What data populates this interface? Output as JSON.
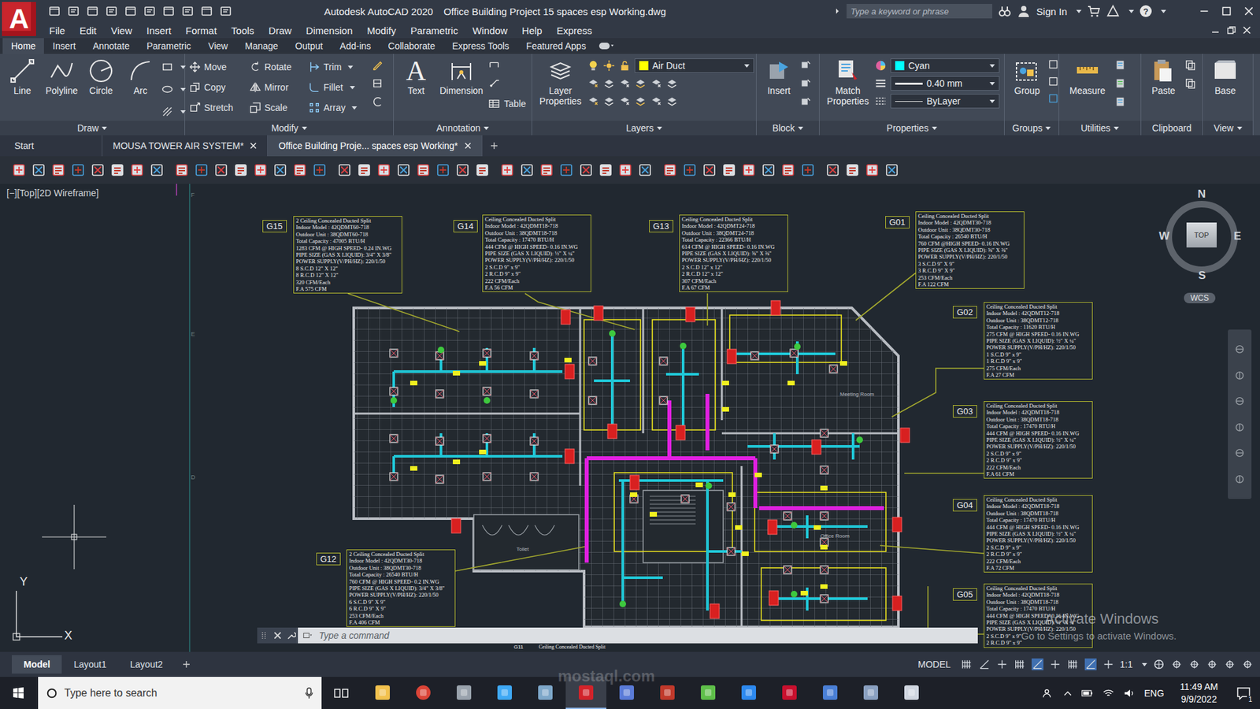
{
  "app": {
    "logo": "A",
    "title": "Autodesk AutoCAD 2020",
    "file": "Office Building Project 15 spaces esp Working.dwg",
    "search_placeholder": "Type a keyword or phrase",
    "sign_in": "Sign In",
    "help": "?"
  },
  "menu": [
    "File",
    "Edit",
    "View",
    "Insert",
    "Format",
    "Tools",
    "Draw",
    "Dimension",
    "Modify",
    "Parametric",
    "Window",
    "Help",
    "Express"
  ],
  "ribbon_tabs": [
    {
      "label": "Home",
      "selected": true
    },
    {
      "label": "Insert",
      "selected": false
    },
    {
      "label": "Annotate",
      "selected": false
    },
    {
      "label": "Parametric",
      "selected": false
    },
    {
      "label": "View",
      "selected": false
    },
    {
      "label": "Manage",
      "selected": false
    },
    {
      "label": "Output",
      "selected": false
    },
    {
      "label": "Add-ins",
      "selected": false
    },
    {
      "label": "Collaborate",
      "selected": false
    },
    {
      "label": "Express Tools",
      "selected": false
    },
    {
      "label": "Featured Apps",
      "selected": false
    }
  ],
  "ribbon": {
    "draw": {
      "title": "Draw",
      "tools": [
        "Line",
        "Polyline",
        "Circle",
        "Arc"
      ]
    },
    "modify": {
      "title": "Modify",
      "tools": [
        {
          "label": "Move",
          "menu": false
        },
        {
          "label": "Rotate",
          "menu": false
        },
        {
          "label": "Trim",
          "menu": true
        },
        {
          "label": "Copy",
          "menu": false
        },
        {
          "label": "Mirror",
          "menu": false
        },
        {
          "label": "Fillet",
          "menu": true
        },
        {
          "label": "Stretch",
          "menu": false
        },
        {
          "label": "Scale",
          "menu": false
        },
        {
          "label": "Array",
          "menu": true
        }
      ]
    },
    "annotation": {
      "title": "Annotation",
      "text_glyph": "A",
      "text": "Text",
      "dimension": "Dimension",
      "table": "Table"
    },
    "layers": {
      "title": "Layers",
      "properties": "Layer Properties",
      "current": "Air Duct",
      "current_color": "#ffff00"
    },
    "block": {
      "title": "Block",
      "insert": "Insert"
    },
    "properties": {
      "title": "Properties",
      "match": "Match Properties",
      "color": "Cyan",
      "color_swatch": "#00ffff",
      "lineweight": "0.40 mm",
      "linetype": "ByLayer"
    },
    "groups": {
      "title": "Groups",
      "group": "Group"
    },
    "utilities": {
      "title": "Utilities",
      "measure": "Measure"
    },
    "clipboard": {
      "title": "Clipboard",
      "paste": "Paste"
    },
    "view": {
      "title": "View",
      "base": "Base"
    }
  },
  "doc_tabs": [
    {
      "label": "Start",
      "selected": false,
      "closable": false
    },
    {
      "label": "MOUSA TOWER AIR SYSTEM*",
      "selected": false,
      "closable": true
    },
    {
      "label": "Office Building Proje... spaces esp Working*",
      "selected": true,
      "closable": true
    }
  ],
  "viewport": {
    "label": "[−][Top][2D Wireframe]",
    "ruler_marks": [
      "F",
      "E",
      "D"
    ],
    "ucs": {
      "x": "X",
      "y": "Y"
    }
  },
  "viewcube": {
    "north": "N",
    "south": "S",
    "west": "W",
    "east": "E",
    "face": "TOP",
    "ucs": "WCS"
  },
  "units": [
    {
      "tag": "G15",
      "lines": [
        "2 Ceiling Concealed Ducted Split",
        "Indoor Model : 42QDMT60-718",
        "Outdoor Unit : 38QDMT60-718",
        "Total Capacity : 47005 BTU/H",
        "1283 CFM @ HIGH SPEED- 0.24 IN.WG",
        "PIPE SIZE (GAS X LIQUID): 3/4\" X 3/8\"",
        "POWER SUPPLY(V/PH/HZ): 220/1/50",
        "8 S.C.D 12\" X 12\"",
        "8 R.C.D 12\" X 12\"",
        "320 CFM/Each",
        "F.A 575 CFM"
      ]
    },
    {
      "tag": "G14",
      "lines": [
        "Ceiling Concealed Ducted Split",
        "Indoor Model : 42QDMT18-718",
        "Outdoor Unit : 38QDMT18-718",
        "Total Capacity : 17470 BTU/H",
        "444 CFM @ HIGH SPEED- 0.16 IN.WG",
        "PIPE SIZE (GAS X LIQUID): ½\" X ¼\"",
        "POWER SUPPLY(V/PH/HZ): 220/1/50",
        "2 S.C.D 9\" x 9\"",
        "2 R.C.D 9\" x 9\"",
        "222 CFM/Each",
        "F.A 56 CFM"
      ]
    },
    {
      "tag": "G13",
      "lines": [
        "Ceiling Concealed Ducted Split",
        "Indoor Model : 42QDMT24-718",
        "Outdoor Unit : 38QDMT24-718",
        "Total Capacity : 22366 BTU/H",
        "614 CFM @ HIGH SPEED- 0.16 IN.WG",
        "PIPE SIZE (GAS X LIQUID): ⅝\" X ⅜\"",
        "POWER SUPPLY(V/PH/HZ): 220/1/50",
        "2 S.C.D 12\" x 12\"",
        "2 R.C.D 12\" x 12\"",
        "307 CFM/Each",
        "F.A 67 CFM"
      ]
    },
    {
      "tag": "G01",
      "lines": [
        "Ceiling Concealed Ducted Split",
        "Indoor Model : 42QDMT30-718",
        "Outdoor Unit : 38QDMT30-718",
        "Total Capacity : 26540 BTU/H",
        "760 CFM @HIGH SPEED- 0.16 IN.WG",
        "PIPE SIZE (GAS X LIQUID): ⅝\" X ⅜\"",
        "POWER SUPPLY(V/PH/HZ): 220/1/50",
        "3 S.C.D 9\" X 9\"",
        "3 R.C.D 9\" X 9\"",
        "253 CFM/Each",
        "F.A 122 CFM"
      ]
    },
    {
      "tag": "G02",
      "lines": [
        "Ceiling Concealed Ducted Split",
        "Indoor Model : 42QDMT12-718",
        "Outdoor Unit : 38QDMT12-718",
        "Total Capacity : 11620 BTU/H",
        "275 CFM @ HIGH SPEED- 0.16 IN.WG",
        "PIPE SIZE (GAS X LIQUID): ½\" X ¼\"",
        "POWER SUPPLY(V/PH/HZ): 220/1/50",
        "1 S.C.D 9\" x 9\"",
        "1 R.C.D 9\" x 9\"",
        "275 CFM/Each",
        "F.A 27 CFM"
      ]
    },
    {
      "tag": "G03",
      "lines": [
        "Ceiling Concealed Ducted Split",
        "Indoor Model : 42QDMT18-718",
        "Outdoor Unit : 38QDMT18-718",
        "Total Capacity : 17470 BTU/H",
        "444 CFM @ HIGH SPEED- 0.16 IN.WG",
        "PIPE SIZE (GAS X LIQUID): ½\" X ¼\"",
        "POWER SUPPLY(V/PH/HZ): 220/1/50",
        "2 S.C.D 9\" x 9\"",
        "2 R.C.D 9\" x 9\"",
        "222 CFM/Each",
        "F.A 61 CFM"
      ]
    },
    {
      "tag": "G04",
      "lines": [
        "Ceiling Concealed Ducted Split",
        "Indoor Model : 42QDMT18-718",
        "Outdoor Unit : 38QDMT18-718",
        "Total Capacity : 17470 BTU/H",
        "444 CFM @ HIGH SPEED- 0.16 IN.WG",
        "PIPE SIZE (GAS X LIQUID): ½\" X ¼\"",
        "POWER SUPPLY(V/PH/HZ): 220/1/50",
        "2 S.C.D 9\" x 9\"",
        "2 R.C.D 9\" x 9\"",
        "222 CFM/Each",
        "F.A 72 CFM"
      ]
    },
    {
      "tag": "G05",
      "lines": [
        "Ceiling Concealed Ducted Split",
        "Indoor Model : 42QDMT18-718",
        "Outdoor Unit : 38QDMT18-718",
        "Total Capacity : 17470 BTU/H",
        "444 CFM @ HIGH SPEED- 0.16 IN.WG",
        "PIPE SIZE (GAS X LIQUID): ½\" X ¼\"",
        "POWER SUPPLY(V/PH/HZ): 220/1/50",
        "2 S.C.D 9\" x 9\"",
        "2 R.C.D 9\" x 9\""
      ]
    },
    {
      "tag": "G12",
      "lines": [
        "2 Ceiling Concealed Ducted Split",
        "Indoor Model : 42QDMT30-718",
        "Outdoor Unit : 38QDMT30-718",
        "Total Capacity : 26540 BTU/H",
        "760 CFM @ HIGH SPEED- 0.2 IN.WG",
        "PIPE SIZE (GAS X LIQUID): 3/4\" X 3/8\"",
        "POWER SUPPLY(V/PH/HZ): 220/1/50",
        "6 S.C.D 9\" X 9\"",
        "6 R.C.D 9\" X 9\"",
        "253 CFM/Each",
        "F.A 406 CFM"
      ]
    },
    {
      "tag": "G11",
      "lines": [
        "Ceiling Concealed Ducted Split"
      ]
    }
  ],
  "plan_labels": [
    "Toilet",
    "Meeting Room",
    "Office Room"
  ],
  "command_line": {
    "placeholder": "Type a command"
  },
  "layout_tabs": [
    {
      "label": "Model",
      "selected": true
    },
    {
      "label": "Layout1",
      "selected": false
    },
    {
      "label": "Layout2",
      "selected": false
    }
  ],
  "status_bar": {
    "space": "MODEL",
    "scale": "1:1"
  },
  "watermark": {
    "title": "Activate Windows",
    "subtitle": "Go to Settings to activate Windows.",
    "site": "mostaql.com"
  },
  "taskbar": {
    "search_placeholder": "Type here to search",
    "apps": [
      {
        "active": false
      },
      {
        "active": false
      },
      {
        "active": false
      },
      {
        "active": false
      },
      {
        "active": false
      },
      {
        "active": true
      },
      {
        "active": false
      },
      {
        "active": false
      },
      {
        "active": false
      },
      {
        "active": false
      },
      {
        "active": false
      },
      {
        "active": false
      },
      {
        "active": false
      },
      {
        "active": false
      }
    ],
    "language": "ENG",
    "time": "11:49 AM",
    "date": "9/9/2022",
    "notifications": "1"
  }
}
